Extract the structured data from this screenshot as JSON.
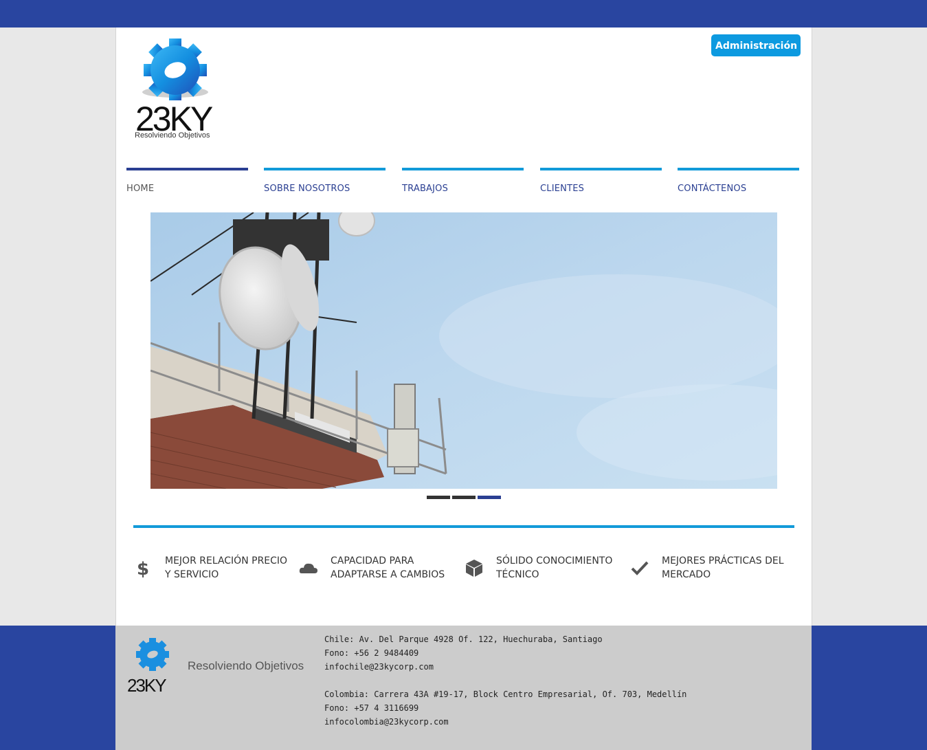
{
  "header": {
    "admin_label": "Administración",
    "logo_text": "23KY",
    "logo_tagline": "Resolviendo Objetivos"
  },
  "nav": {
    "items": [
      {
        "label": "HOME",
        "active": true
      },
      {
        "label": "SOBRE NOSOTROS",
        "active": false
      },
      {
        "label": "TRABAJOS",
        "active": false
      },
      {
        "label": "CLIENTES",
        "active": false
      },
      {
        "label": "CONTÁCTENOS",
        "active": false
      }
    ]
  },
  "slider": {
    "active_index": 2,
    "count": 3
  },
  "features": [
    {
      "icon": "dollar-icon",
      "text": "Mejor relación precio y servicio"
    },
    {
      "icon": "cloud-icon",
      "text": "Capacidad para adaptarse a cambios"
    },
    {
      "icon": "cube-icon",
      "text": "Sólido conocimiento técnico"
    },
    {
      "icon": "check-icon",
      "text": "Mejores prácticas del mercado"
    }
  ],
  "footer": {
    "logo_text": "23KY",
    "tagline": "Resolviendo Objetivos",
    "chile": {
      "address": "Chile: Av. Del Parque 4928 Of. 122, Huechuraba, Santiago",
      "phone": "Fono: +56 2 9484409",
      "email": "infochile@23kycorp.com"
    },
    "colombia": {
      "address": "Colombia: Carrera 43A #19-17, Block Centro Empresarial, Of. 703, Medellín",
      "phone": "Fono: +57 4 3116699",
      "email": "infocolombia@23kycorp.com"
    }
  },
  "colors": {
    "brand_blue": "#2945a0",
    "accent_cyan": "#129ad9",
    "button_blue": "#0d9ae0",
    "footer_gray": "#cccccc"
  }
}
